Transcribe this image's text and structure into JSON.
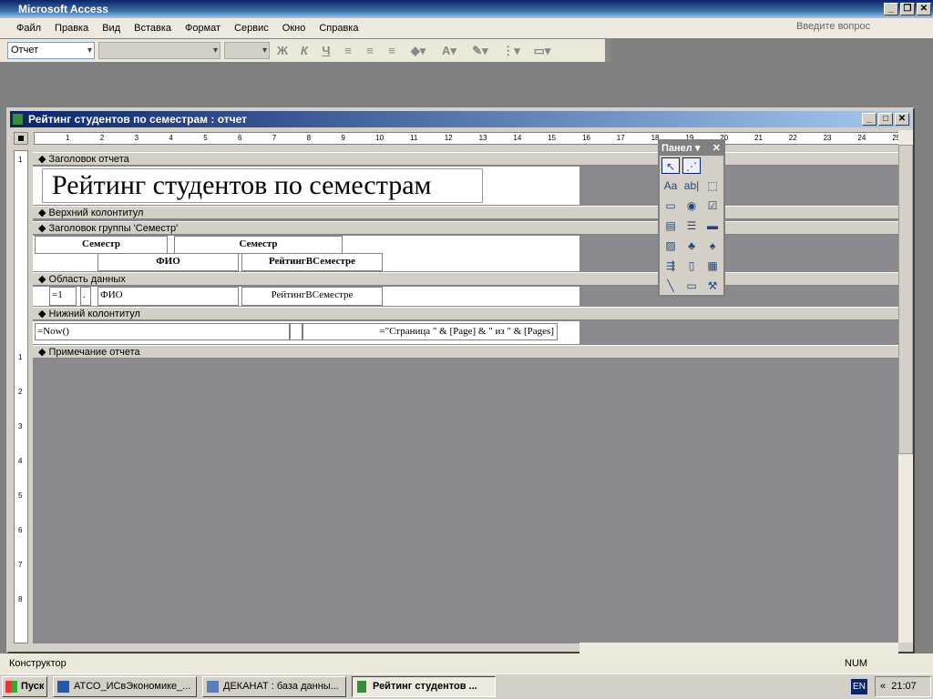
{
  "app": {
    "title": "Microsoft Access"
  },
  "menu": [
    "Файл",
    "Правка",
    "Вид",
    "Вставка",
    "Формат",
    "Сервис",
    "Окно",
    "Справка"
  ],
  "ask_placeholder": "Введите вопрос",
  "toolbar": {
    "object_combo": "Отчет",
    "bold": "Ж",
    "italic": "К",
    "underline": "Ч",
    "font_color": "A"
  },
  "report": {
    "window_title": "Рейтинг  студентов по  семестрам : отчет",
    "ruler_ticks": [
      "1",
      "2",
      "3",
      "4",
      "5",
      "6",
      "7",
      "8",
      "9",
      "10",
      "11",
      "12",
      "13",
      "14",
      "15",
      "16",
      "17",
      "18",
      "19",
      "20",
      "21",
      "22",
      "23",
      "24",
      "25"
    ],
    "vruler_labels": [
      "1",
      "1",
      "2",
      "3",
      "4",
      "5",
      "6",
      "7",
      "8"
    ],
    "sections": {
      "report_header": "Заголовок отчета",
      "page_header": "Верхний колонтитул",
      "group_header": "Заголовок группы 'Семестр'",
      "detail": "Область данных",
      "page_footer": "Нижний колонтитул",
      "report_footer": "Примечание отчета"
    },
    "controls": {
      "title": "Рейтинг  студентов по  семестрам",
      "sem_label": "Семестр",
      "sem_field": "Семестр",
      "fio_label": "ФИО",
      "rating_label": "РейтингВСеместре",
      "counter": "=1",
      "dot": ".",
      "fio_field": "ФИО",
      "rating_field": "РейтингВСеместре",
      "now": "=Now()",
      "pages": "=\"Страница \" & [Page] & \" из \" & [Pages]"
    }
  },
  "toolbox": {
    "title": "Панел",
    "tools": [
      "select",
      "wizard",
      "label",
      "textbox",
      "option-group",
      "toggle",
      "option",
      "checkbox",
      "combo",
      "list",
      "button",
      "image",
      "unbound-object",
      "bound-object",
      "page-break",
      "tab",
      "subform",
      "line",
      "rectangle",
      "more-controls"
    ]
  },
  "status": {
    "mode": "Конструктор",
    "num": "NUM"
  },
  "taskbar": {
    "start": "Пуск",
    "tasks": [
      "АТСО_ИСвЭкономике_...",
      "ДЕКАНАТ : база данны...",
      "Рейтинг  студентов ..."
    ],
    "lang": "EN",
    "clock": "21:07"
  }
}
